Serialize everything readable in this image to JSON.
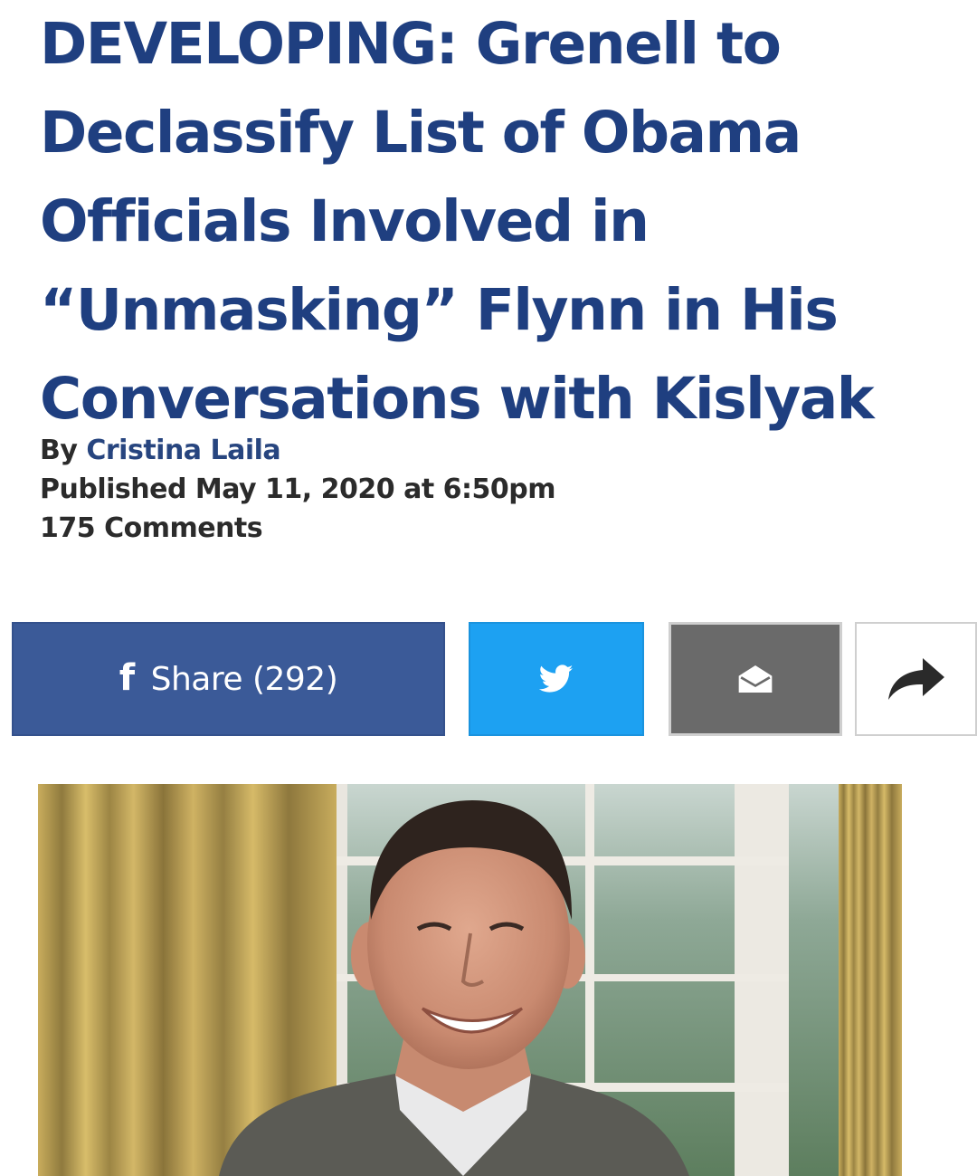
{
  "article": {
    "headline_lines": [
      "DEVELOPING: Grenell to",
      "Declassify List of Obama",
      "Officials Involved in",
      "“Unmasking” Flynn in His",
      "Conversations with Kislyak"
    ],
    "byline_prefix": "By",
    "author": "Cristina Laila",
    "published": "Published May 11, 2020 at 6:50pm",
    "comments": "175 Comments"
  },
  "share": {
    "facebook_icon": "f",
    "facebook_label": "Share (292)",
    "twitter_icon": "twitter-bird-icon",
    "email_icon": "envelope-icon",
    "more_icon": "share-arrow-icon"
  },
  "colors": {
    "headline": "#1f3f80",
    "facebook": "#3b5a98",
    "twitter": "#1da1f2",
    "email": "#6a6a6a"
  },
  "photo": {
    "subject": "smiling man in suit and tie standing in front of gold curtains and a window"
  }
}
